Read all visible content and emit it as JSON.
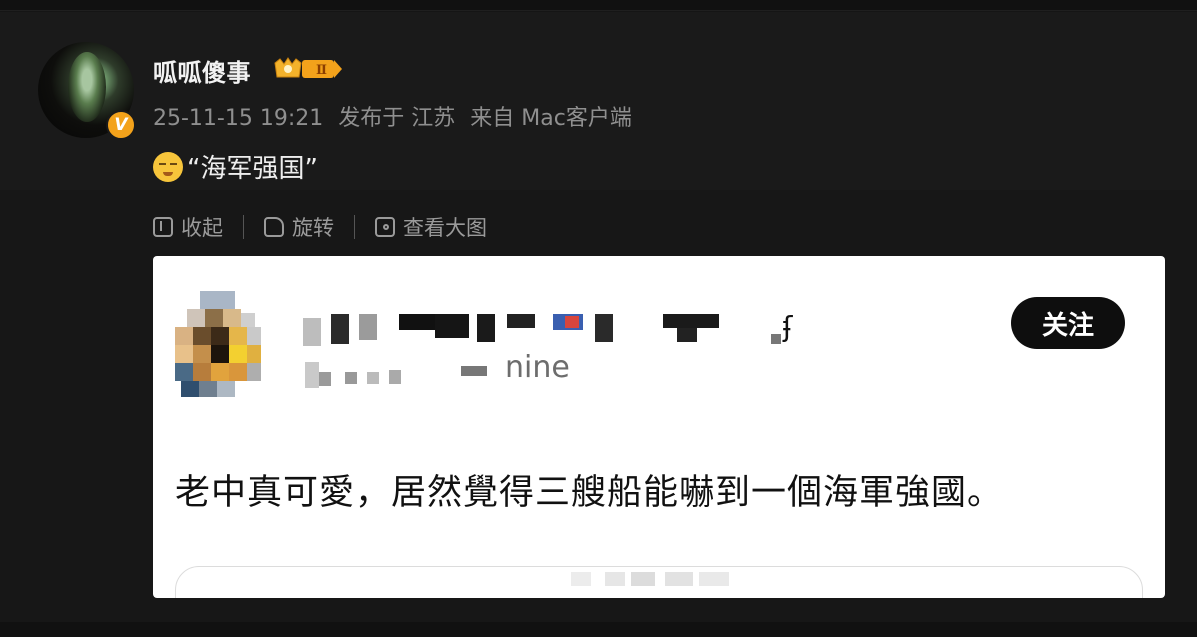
{
  "post": {
    "username": "呱呱傻事",
    "level_badge": "Ⅱ",
    "verified_badge": "V",
    "meta": {
      "timestamp": "25-11-15 19:21",
      "location": "发布于 江苏",
      "source": "来自 Mac客户端"
    },
    "text": "“海军强国”"
  },
  "actions": {
    "collapse": "收起",
    "rotate": "旋转",
    "view_large": "查看大图"
  },
  "embedded_image": {
    "handle_suffix": "nine",
    "follow_label": "关注",
    "quote_text": "老中真可愛，居然覺得三艘船能嚇到一個海軍強國。"
  },
  "colors": {
    "background": "#151515",
    "badge_orange": "#f3a21b",
    "follow_button": "#0e0e0e"
  }
}
